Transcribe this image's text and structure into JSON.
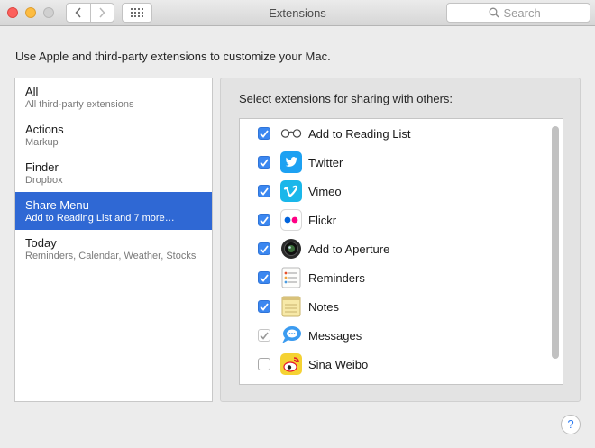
{
  "window": {
    "title": "Extensions"
  },
  "toolbar": {
    "search_placeholder": "Search",
    "back_icon": "chevron-left-icon",
    "forward_icon": "chevron-right-icon",
    "grid_icon": "show-all-grid-icon"
  },
  "intro": "Use Apple and third-party extensions to customize your Mac.",
  "sidebar": {
    "items": [
      {
        "title": "All",
        "subtitle": "All third-party extensions",
        "selected": false
      },
      {
        "title": "Actions",
        "subtitle": "Markup",
        "selected": false
      },
      {
        "title": "Finder",
        "subtitle": "Dropbox",
        "selected": false
      },
      {
        "title": "Share Menu",
        "subtitle": "Add to Reading List and 7 more…",
        "selected": true
      },
      {
        "title": "Today",
        "subtitle": "Reminders, Calendar, Weather, Stocks",
        "selected": false
      }
    ]
  },
  "panel": {
    "label": "Select extensions for sharing with others:",
    "extensions": [
      {
        "label": "Add to Reading List",
        "checked": true,
        "enabled": true,
        "icon": "reading-list-glasses-icon"
      },
      {
        "label": "Twitter",
        "checked": true,
        "enabled": true,
        "icon": "twitter-icon"
      },
      {
        "label": "Vimeo",
        "checked": true,
        "enabled": true,
        "icon": "vimeo-icon"
      },
      {
        "label": "Flickr",
        "checked": true,
        "enabled": true,
        "icon": "flickr-icon"
      },
      {
        "label": "Add to Aperture",
        "checked": true,
        "enabled": true,
        "icon": "aperture-icon"
      },
      {
        "label": "Reminders",
        "checked": true,
        "enabled": true,
        "icon": "reminders-icon"
      },
      {
        "label": "Notes",
        "checked": true,
        "enabled": true,
        "icon": "notes-icon"
      },
      {
        "label": "Messages",
        "checked": true,
        "enabled": false,
        "icon": "messages-icon"
      },
      {
        "label": "Sina Weibo",
        "checked": false,
        "enabled": true,
        "icon": "sina-weibo-icon"
      }
    ]
  },
  "colors": {
    "selection": "#2f68d4",
    "checkbox": "#3b87f0",
    "twitter": "#1da1f2",
    "vimeo": "#1ab7ea"
  },
  "help": {
    "label": "?"
  }
}
